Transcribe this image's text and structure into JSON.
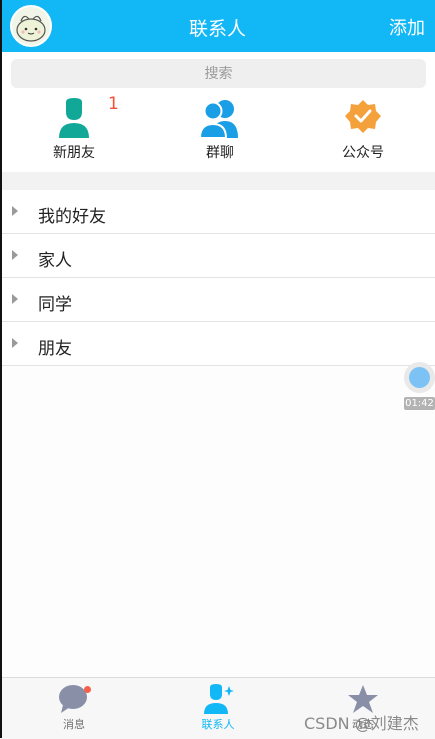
{
  "header": {
    "title": "联系人",
    "add_label": "添加"
  },
  "search": {
    "placeholder": "搜索"
  },
  "quick_actions": [
    {
      "label": "新朋友",
      "badge": "1",
      "icon": "person-icon",
      "color": "#12a898"
    },
    {
      "label": "群聊",
      "icon": "group-icon",
      "color": "#1a9ee6"
    },
    {
      "label": "公众号",
      "icon": "verified-badge-icon",
      "color": "#f5a13b"
    }
  ],
  "groups": [
    {
      "name": "我的好友"
    },
    {
      "name": "家人"
    },
    {
      "name": "同学"
    },
    {
      "name": "朋友"
    }
  ],
  "floating_recorder": {
    "time": "01:42"
  },
  "tabs": [
    {
      "label": "消息",
      "icon": "chat-bubble-icon",
      "active": false,
      "dot": true
    },
    {
      "label": "联系人",
      "icon": "contacts-icon",
      "active": true
    },
    {
      "label": "动态",
      "icon": "star-icon",
      "active": false
    }
  ],
  "watermark": "CSDN @刘建杰",
  "colors": {
    "accent": "#12b7f5",
    "badge": "#f5503a"
  }
}
